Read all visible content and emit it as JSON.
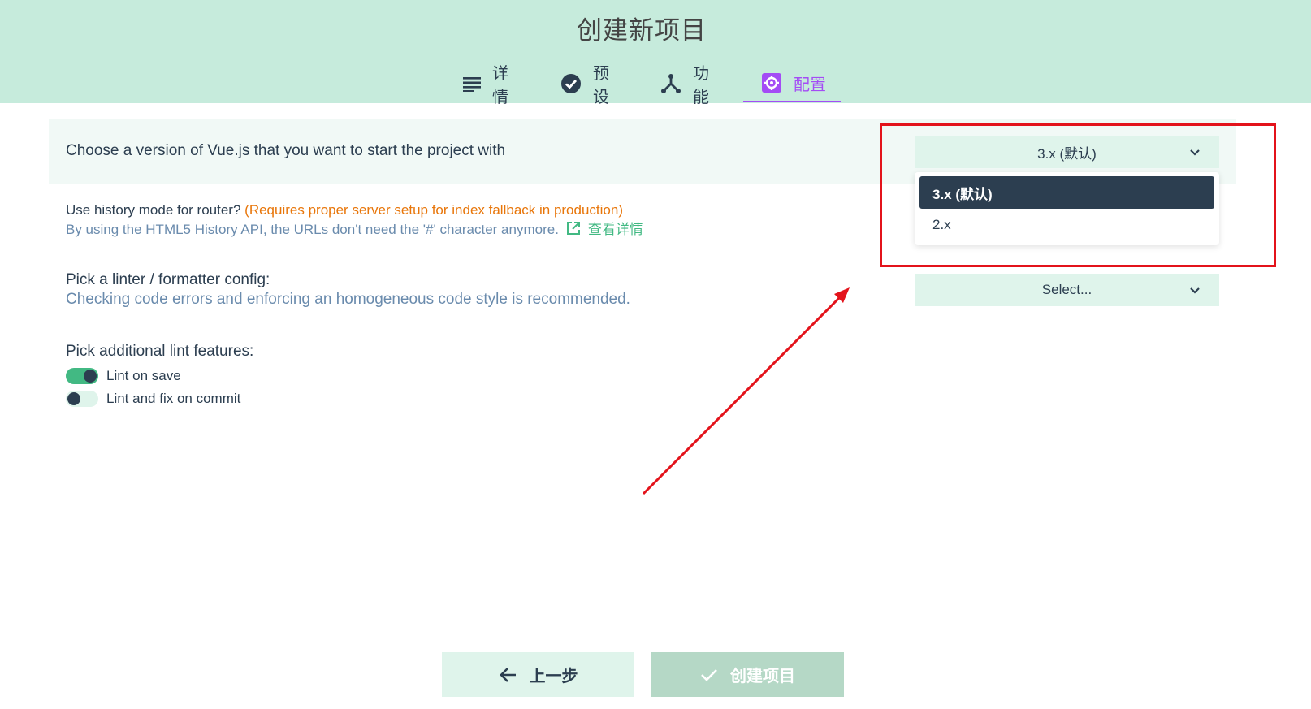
{
  "header": {
    "title": "创建新项目",
    "tabs": [
      {
        "label": "详情",
        "icon": "list-icon"
      },
      {
        "label": "预设",
        "icon": "check-circle-icon"
      },
      {
        "label": "功能",
        "icon": "fork-icon"
      },
      {
        "label": "配置",
        "icon": "settings-app-icon",
        "active": true
      }
    ]
  },
  "vue_version": {
    "question": "Choose a version of Vue.js that you want to start the project with",
    "selected": "3.x (默认)",
    "options": [
      "3.x (默认)",
      "2.x"
    ]
  },
  "router": {
    "label": "Use history mode for router?",
    "warning": "(Requires proper server setup for index fallback in production)",
    "description": "By using the HTML5 History API, the URLs don't need the '#' character anymore.",
    "more_link": "查看详情"
  },
  "linter": {
    "label": "Pick a linter / formatter config:",
    "description": "Checking code errors and enforcing an homogeneous code style is recommended.",
    "select_placeholder": "Select..."
  },
  "lint_features": {
    "label": "Pick additional lint features:",
    "items": [
      {
        "label": "Lint on save",
        "enabled": true
      },
      {
        "label": "Lint and fix on commit",
        "enabled": false
      }
    ]
  },
  "footer": {
    "prev_label": "上一步",
    "create_label": "创建项目"
  },
  "colors": {
    "accent": "#42b983",
    "header_bg": "#c6ebdc",
    "active_tab": "#a44cf5",
    "dark": "#2c3e50",
    "annotation_red": "#e3131b"
  }
}
